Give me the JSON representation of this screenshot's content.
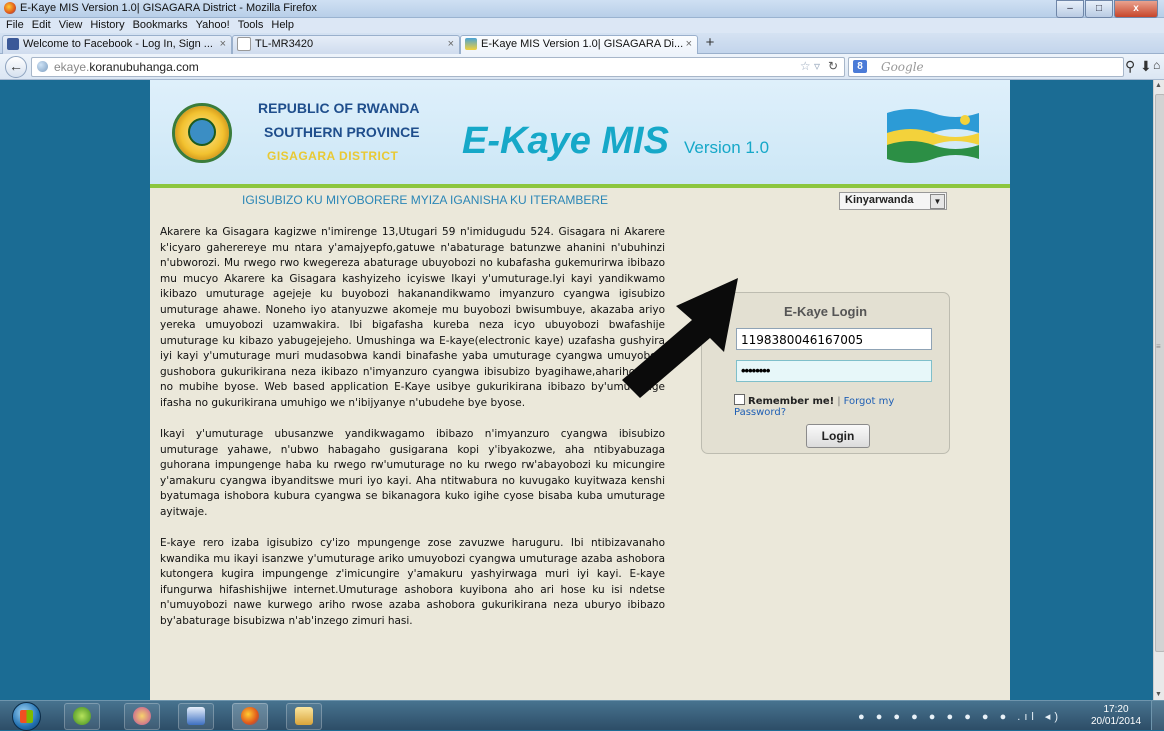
{
  "window": {
    "title": "E-Kaye MIS Version 1.0| GISAGARA District - Mozilla Firefox",
    "buttons": {
      "minimize": "–",
      "maximize": "□",
      "close": "x"
    }
  },
  "menu": [
    "File",
    "Edit",
    "View",
    "History",
    "Bookmarks",
    "Yahoo!",
    "Tools",
    "Help"
  ],
  "tabs": [
    {
      "label": "Welcome to Facebook - Log In, Sign ...",
      "close": "×"
    },
    {
      "label": "TL-MR3420",
      "close": "×"
    },
    {
      "label": "E-Kaye MIS Version 1.0| GISAGARA Di...",
      "close": "×",
      "active": true
    }
  ],
  "new_tab": "+",
  "navbar": {
    "url_prefix": "ekaye.",
    "url_domain": "koranubuhanga.com",
    "search_placeholder": "Google",
    "search_engine_badge": "8"
  },
  "header": {
    "line1": "REPUBLIC OF RWANDA",
    "line2": "SOUTHERN PROVINCE",
    "line3": "GISAGARA DISTRICT",
    "brand": "E-Kaye MIS",
    "version": "Version 1.0"
  },
  "subtitle": "IGISUBIZO KU MIYOBORERE MYIZA IGANISHA KU ITERAMBERE",
  "language": {
    "selected": "Kinyarwanda"
  },
  "article": [
    "Akarere ka Gisagara kagizwe n'imirenge 13,Utugari 59 n'imidugudu 524. Gisagara ni Akarere k'icyaro gaherereye mu ntara y'amajyepfo,gatuwe n'abaturage batunzwe ahanini n'ubuhinzi n'ubworozi. Mu rwego rwo kwegereza abaturage ubuyobozi no kubafasha gukemurirwa ibibazo mu mucyo Akarere ka Gisagara kashyizeho icyiswe Ikayi y'umuturage.Iyi kayi yandikwamo ikibazo umuturage agejeje ku buyobozi hakanandikwamo imyanzuro cyangwa igisubizo umuturage ahawe. Noneho iyo atanyuzwe akomeje mu buyobozi bwisumbuye, akazaba ariyo yereka umuyobozi uzamwakira. Ibi bigafasha kureba neza icyo ubuyobozi bwafashije umuturage ku kibazo yabugejejeho. Umushinga wa E-kaye(electronic kaye) uzafasha gushyira iyi kayi y'umuturage muri mudasobwa kandi binafashe yaba umuturage cyangwa umuyobozi gushobora gukurikirana neza ikibazo n'imyanzuro cyangwa ibisubizo byagihawe,ahariho hose no mubihe byose. Web based application E-Kaye usibye gukurikirana ibibazo by'umuturage ifasha no gukurikirana umuhigo we n'ibijyanye n'ubudehe bye byose.",
    "Ikayi y'umuturage ubusanzwe yandikwagamo ibibazo n'imyanzuro cyangwa ibisubizo umuturage yahawe, n'ubwo habagaho gusigarana kopi y'ibyakozwe, aha ntibyabuzaga guhorana impungenge haba ku rwego rw'umuturage no ku rwego rw'abayobozi ku micungire y'amakuru cyangwa ibyanditswe muri iyo kayi. Aha ntitwabura no kuvugako kuyitwaza kenshi byatumaga ishobora kubura cyangwa se bikanagora kuko igihe cyose bisaba kuba umuturage ayitwaje.",
    "E-kaye rero izaba igisubizo cy'izo mpungenge zose zavuzwe haruguru. Ibi ntibizavanaho kwandika mu ikayi isanzwe y'umuturage ariko umuyobozi cyangwa umuturage azaba ashobora kutongera kugira impungenge z'imicungire y'amakuru yashyirwaga muri iyi kayi. E-kaye ifungurwa hifashishijwe internet.Umuturage ashobora kuyibona aho ari hose ku isi ndetse n'umuyobozi nawe kurwego ariho rwose azaba ashobora gukurikirana neza uburyo ibibazo by'abaturage bisubizwa n'ab'inzego zimuri hasi."
  ],
  "login": {
    "title": "E-Kaye Login",
    "username_value": "1198380046167005",
    "password_mask": "••••••••",
    "remember_label": "Remember me!",
    "separator": "|",
    "forgot_label": "Forgot my Password?",
    "button_label": "Login"
  },
  "taskbar": {
    "time": "17:20",
    "date": "20/01/2014"
  },
  "colors": {
    "page_background": "#1b6c94",
    "brand": "#16a8c8",
    "header_text": "#1f4e8c",
    "district_text": "#e9c934",
    "accent_green": "#8cc63f",
    "link": "#1f5fb4"
  }
}
